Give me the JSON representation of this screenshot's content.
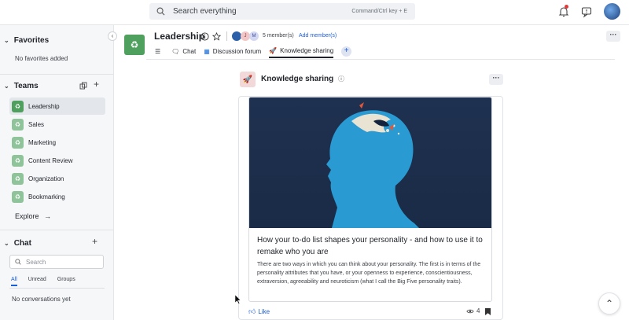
{
  "search": {
    "placeholder": "Search everything",
    "shortcut": "Command/Ctrl key + E"
  },
  "favorites": {
    "title": "Favorites",
    "empty": "No favorites added"
  },
  "teams": {
    "title": "Teams",
    "items": [
      {
        "label": "Leadership"
      },
      {
        "label": "Sales"
      },
      {
        "label": "Marketing"
      },
      {
        "label": "Content Review"
      },
      {
        "label": "Organization"
      },
      {
        "label": "Bookmarking"
      }
    ],
    "explore": "Explore"
  },
  "chat": {
    "title": "Chat",
    "search_placeholder": "Search",
    "tabs": [
      "All",
      "Unread",
      "Groups"
    ],
    "empty": "No conversations yet"
  },
  "team_header": {
    "title": "Leadership",
    "member_initials": [
      "",
      "J",
      "M"
    ],
    "members": "5 member(s)",
    "add_members": "Add member(s)",
    "tabs": [
      {
        "label": "Chat"
      },
      {
        "label": "Discussion forum"
      },
      {
        "label": "Knowledge sharing"
      }
    ]
  },
  "page": {
    "title": "Knowledge sharing",
    "article": {
      "title": "How your to-do list shapes your personality - and how to use it to remake who you are",
      "description": "There are two ways in which you can think about your personality. The first is in terms of the personality attributes that you have, or your openness to experience, conscientiousness, extraversion, agreeability and neuroticism (what I call the Big Five personality traits).",
      "like_label": "Like",
      "views": "4"
    }
  },
  "colors": {
    "accent": "#1a5dd8",
    "team_green": "#4fa05e",
    "image_bg": "#1f3150"
  }
}
